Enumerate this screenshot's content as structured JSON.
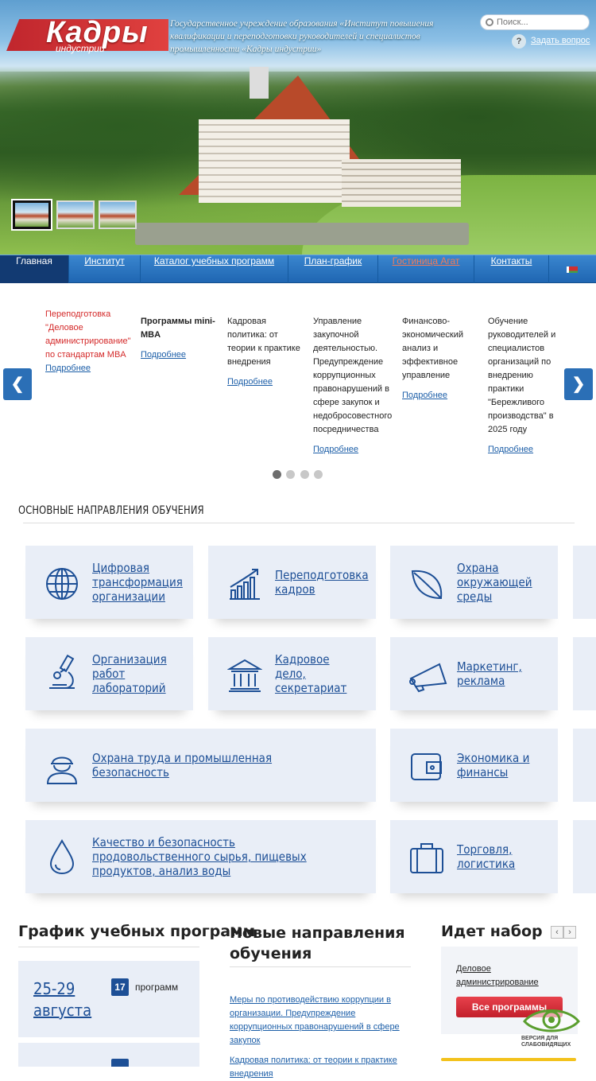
{
  "header": {
    "logo_text": "Кадры",
    "logo_sub": "индустрии",
    "org_name": "Государственное учреждение образования «Институт повышения квалификации и переподготовки руководителей и специалистов промышленности «Кадры индустрии»",
    "search_placeholder": "Поиск...",
    "ask_icon": "?",
    "ask_label": "Задать вопрос"
  },
  "nav": {
    "items": [
      "Главная",
      "Институт",
      "Каталог учебных программ",
      "План-график",
      "Гостиница Агат",
      "Контакты"
    ],
    "active": "Главная",
    "highlight_color": "#f07b5a"
  },
  "carousel": {
    "prev": "❮",
    "next": "❯",
    "slides": [
      {
        "text": "Переподготовка \"Деловое администрирование\" по стандартам MBA",
        "link": "Подробнее"
      },
      {
        "text": "Программы mini-MBA",
        "link": "Подробнее"
      },
      {
        "text": "Кадровая политика: от теории к практике внедрения",
        "link": "Подробнее"
      },
      {
        "text": "Управление закупочной деятельностью. Предупреждение коррупционных правонарушений в сфере закупок и недобросовестного посредничества",
        "link": "Подробнее"
      },
      {
        "text": "Финансово-экономический анализ и эффективное управление",
        "link": "Подробнее"
      },
      {
        "text": "Обучение руководителей и специалистов организаций по внедрению практики \"Бережливого производства\" в 2025 году",
        "link": "Подробнее"
      }
    ],
    "pages": 4,
    "active_page": 1
  },
  "directions": {
    "title": "ОСНОВНЫЕ НАПРАВЛЕНИЯ ОБУЧЕНИЯ",
    "items": [
      {
        "label": "Цифровая трансформация организации",
        "icon": "globe-icon"
      },
      {
        "label": "Переподготовка кадров",
        "icon": "growth-chart-icon"
      },
      {
        "label": "Охрана окружающей среды",
        "icon": "leaf-icon"
      },
      {
        "label": "Организация работ лабораторий",
        "icon": "microscope-icon"
      },
      {
        "label": "Кадровое дело, секретариат",
        "icon": "institution-icon"
      },
      {
        "label": "Маркетинг, реклама",
        "icon": "megaphone-icon"
      },
      {
        "label": "Охрана труда и промышленная безопасность",
        "icon": "worker-helmet-icon"
      },
      {
        "label": "Экономика и финансы",
        "icon": "wallet-icon"
      },
      {
        "label": "Качество и безопасность продовольственного сырья, пищевых продуктов, анализ воды",
        "icon": "water-drop-icon"
      },
      {
        "label": "Торговля, логистика",
        "icon": "suitcase-icon"
      }
    ]
  },
  "schedule": {
    "title": "График учебных программ",
    "entries": [
      {
        "date": "25-29 августа",
        "count": "17",
        "label": "программ"
      }
    ]
  },
  "new_directions": {
    "title": "Новые направления обучения",
    "items": [
      "Меры по противодействию коррупции в организации. Предупреждение коррупционных правонарушений в сфере закупок",
      "Кадровая политика: от теории к практике внедрения"
    ]
  },
  "recruiting": {
    "title": "Идет набор",
    "prev": "‹",
    "next": "›",
    "course": "Деловое администрирование",
    "button": "Все программы"
  },
  "accessibility": {
    "label": "ВЕРСИЯ ДЛЯ СЛАБОВИДЯЩИХ"
  }
}
